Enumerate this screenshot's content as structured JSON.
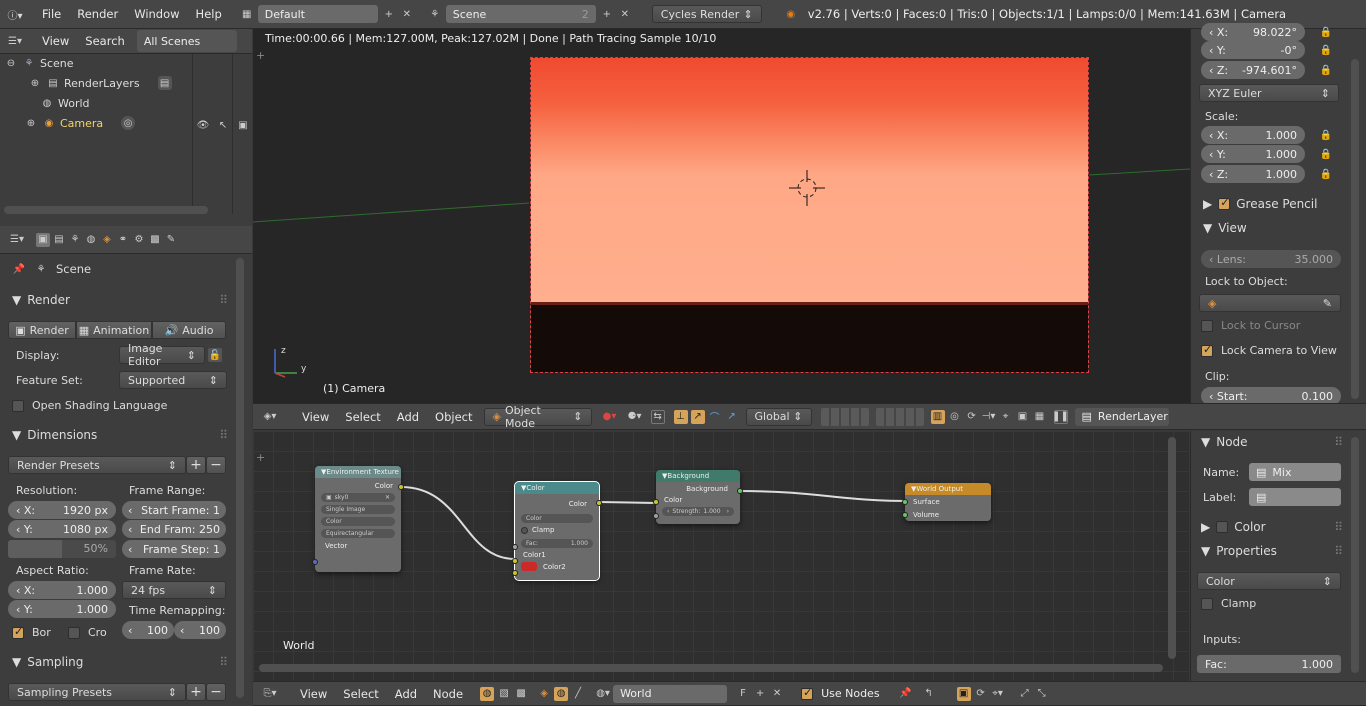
{
  "topbar": {
    "menus": [
      "File",
      "Render",
      "Window",
      "Help"
    ],
    "layout_name": "Default",
    "scene_name": "Scene",
    "scene_users": "2",
    "engine": "Cycles Render",
    "stats": "v2.76 | Verts:0 | Faces:0 | Tris:0 | Objects:1/1 | Lamps:0/0 | Mem:141.63M | Camera"
  },
  "outliner": {
    "menus": [
      "View",
      "Search",
      "All Scenes"
    ],
    "items": [
      "Scene",
      "RenderLayers",
      "World",
      "Camera"
    ]
  },
  "properties": {
    "context": "Scene",
    "render": {
      "title": "Render",
      "buttons": [
        "Render",
        "Animation",
        "Audio"
      ],
      "display_label": "Display:",
      "display_value": "Image Editor",
      "feature_label": "Feature Set:",
      "feature_value": "Supported",
      "osl_label": "Open Shading Language"
    },
    "dimensions": {
      "title": "Dimensions",
      "presets": "Render Presets",
      "resolution_label": "Resolution:",
      "res_x": "1920 px",
      "res_y": "1080 px",
      "percent": "50%",
      "percent_value": 0.5,
      "frame_range_label": "Frame Range:",
      "start": "Start Frame: 1",
      "end": "End Fram: 250",
      "step": "Frame Step: 1",
      "aspect_label": "Aspect Ratio:",
      "aspect_x": "1.000",
      "aspect_y": "1.000",
      "frame_rate_label": "Frame Rate:",
      "fps": "24 fps",
      "remap_label": "Time Remapping:",
      "remap_old": "100",
      "remap_new": "100",
      "border": "Bor",
      "crop": "Cro"
    },
    "sampling": {
      "title": "Sampling",
      "presets": "Sampling Presets"
    }
  },
  "viewport": {
    "status": "Time:00:00.66 | Mem:127.00M, Peak:127.02M | Done | Path Tracing Sample 10/10",
    "camera_label": "(1) Camera",
    "axis_labels": [
      "z",
      "y"
    ],
    "menus": [
      "View",
      "Select",
      "Add",
      "Object"
    ],
    "mode": "Object Mode",
    "orientation": "Global",
    "layer": "RenderLayer"
  },
  "n_panel": {
    "loc_x": "98.022°",
    "loc_y": "-0°",
    "loc_z": "-974.601°",
    "rot_mode": "XYZ Euler",
    "scale_label": "Scale:",
    "scale_x": "1.000",
    "scale_y": "1.000",
    "scale_z": "1.000",
    "grease_pencil": "Grease Pencil",
    "view_title": "View",
    "lens_label": "Lens:",
    "lens": "35.000",
    "lock_obj_label": "Lock to Object:",
    "lock_cursor": "Lock to Cursor",
    "lock_camera": "Lock Camera to View",
    "clip_label": "Clip:",
    "clip_start_label": "Start:",
    "clip_start": "0.100"
  },
  "node_editor": {
    "label": "World",
    "nodes": {
      "env": {
        "title": "Environment Texture",
        "out": "Color",
        "image": "sky0",
        "proj1": "Single Image",
        "proj2": "Color",
        "proj3": "Equirectangular",
        "in": "Vector"
      },
      "mix": {
        "title": "Color",
        "out": "Color",
        "type": "Color",
        "clamp": "Clamp",
        "fac": "Fac:",
        "fac_val": "1.000",
        "c1": "Color1",
        "c2": "Color2"
      },
      "bg": {
        "title": "Background",
        "out": "Background",
        "in": "Color",
        "strength": "Strength:",
        "strength_val": "1.000"
      },
      "wo": {
        "title": "World Output",
        "in1": "Surface",
        "in2": "Volume"
      }
    },
    "sidebar": {
      "node_title": "Node",
      "name_label": "Name:",
      "name": "Mix",
      "label_label": "Label:",
      "color_title": "Color",
      "props_title": "Properties",
      "blend": "Color",
      "clamp": "Clamp",
      "inputs_label": "Inputs:",
      "fac_label": "Fac:",
      "fac": "1.000"
    },
    "footer": {
      "menus": [
        "View",
        "Select",
        "Add",
        "Node"
      ],
      "world": "World",
      "use_nodes": "Use Nodes"
    }
  },
  "colors": {
    "accent": "#d6a35a",
    "bg": "#393939",
    "sky_top": "#f25a3a",
    "sky_bottom": "#ffab8a"
  }
}
